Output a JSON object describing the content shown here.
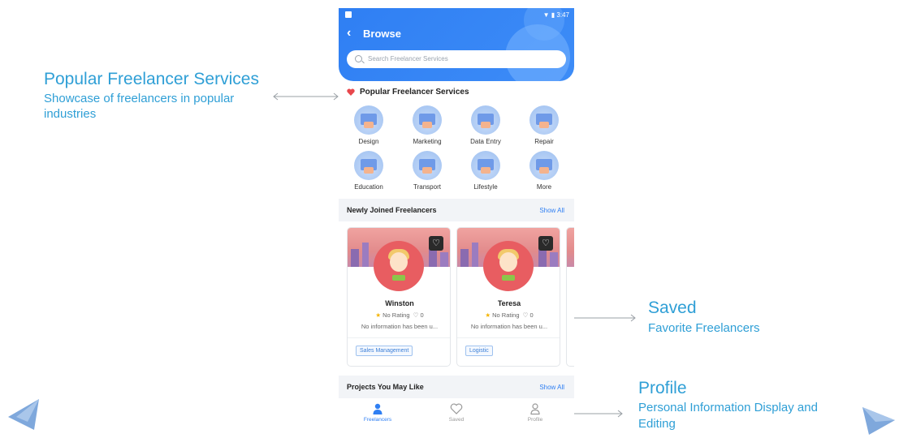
{
  "annotations": {
    "popular": {
      "title": "Popular Freelancer Services",
      "sub_line1": "Showcase of freelancers in popular",
      "sub_line2": "industries"
    },
    "saved": {
      "title": "Saved",
      "sub": "Favorite Freelancers"
    },
    "profile": {
      "title": "Profile",
      "sub_line1": "Personal Information Display and",
      "sub_line2": "Editing"
    }
  },
  "status_bar": {
    "time": "3:47"
  },
  "header": {
    "title": "Browse",
    "search_placeholder": "Search Freelancer Services"
  },
  "popular_section": {
    "title": "Popular Freelancer Services"
  },
  "categories": [
    {
      "label": "Design",
      "icon": "design-icon"
    },
    {
      "label": "Marketing",
      "icon": "marketing-icon"
    },
    {
      "label": "Data Entry",
      "icon": "data-entry-icon"
    },
    {
      "label": "Repair",
      "icon": "repair-icon"
    },
    {
      "label": "Education",
      "icon": "education-icon"
    },
    {
      "label": "Transport",
      "icon": "transport-icon"
    },
    {
      "label": "Lifestyle",
      "icon": "lifestyle-icon"
    },
    {
      "label": "More",
      "icon": "more-icon"
    }
  ],
  "newly_joined": {
    "title": "Newly Joined Freelancers",
    "show_all": "Show All",
    "cards": [
      {
        "name": "Winston",
        "rating": "No Rating",
        "likes": "0",
        "info": "No information has been u...",
        "tag": "Sales Management"
      },
      {
        "name": "Teresa",
        "rating": "No Rating",
        "likes": "0",
        "info": "No information has been u...",
        "tag": "Logistic"
      }
    ]
  },
  "projects": {
    "title": "Projects You May Like",
    "show_all": "Show All"
  },
  "tabs": [
    {
      "label": "Freelancers",
      "icon": "person-icon",
      "active": true
    },
    {
      "label": "Saved",
      "icon": "heart-icon",
      "active": false
    },
    {
      "label": "Profile",
      "icon": "profile-icon",
      "active": false
    }
  ],
  "colors": {
    "primary": "#2f7ff3",
    "annotation": "#2f9fd6",
    "avatar": "#e85d61"
  }
}
